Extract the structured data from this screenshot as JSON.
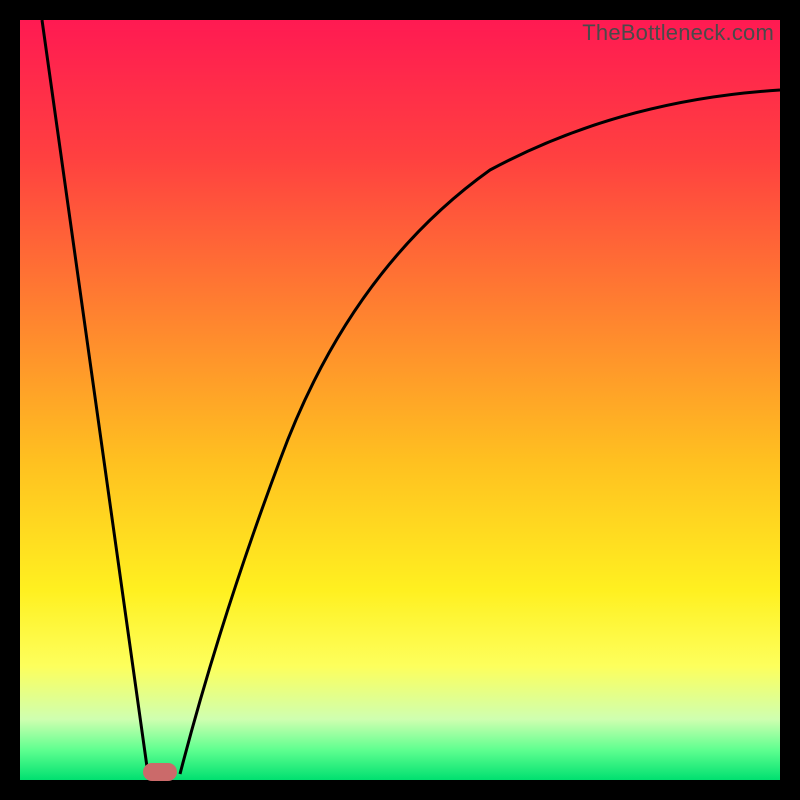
{
  "watermark": "TheBottleneck.com",
  "chart_data": {
    "type": "line",
    "title": "",
    "xlabel": "",
    "ylabel": "",
    "xlim": [
      0,
      100
    ],
    "ylim": [
      0,
      100
    ],
    "grid": false,
    "legend": false,
    "series": [
      {
        "name": "left-branch",
        "x": [
          3,
          16.8
        ],
        "values": [
          100,
          1
        ]
      },
      {
        "name": "right-branch",
        "x": [
          21,
          24,
          28,
          32,
          36,
          40,
          45,
          50,
          56,
          63,
          72,
          82,
          92,
          100
        ],
        "values": [
          1,
          8,
          20,
          32,
          43,
          52,
          60,
          67,
          73,
          78,
          83,
          87,
          89.5,
          91
        ]
      }
    ],
    "marker": {
      "x": 18.5,
      "y": 1
    },
    "gradient_stops": [
      {
        "pos": 0,
        "color": "#ff1a52"
      },
      {
        "pos": 18,
        "color": "#ff4040"
      },
      {
        "pos": 38,
        "color": "#ff8030"
      },
      {
        "pos": 58,
        "color": "#ffc020"
      },
      {
        "pos": 75,
        "color": "#fff020"
      },
      {
        "pos": 85,
        "color": "#fdff5c"
      },
      {
        "pos": 92,
        "color": "#cfffb0"
      },
      {
        "pos": 96,
        "color": "#60ff90"
      },
      {
        "pos": 100,
        "color": "#00e070"
      }
    ]
  }
}
